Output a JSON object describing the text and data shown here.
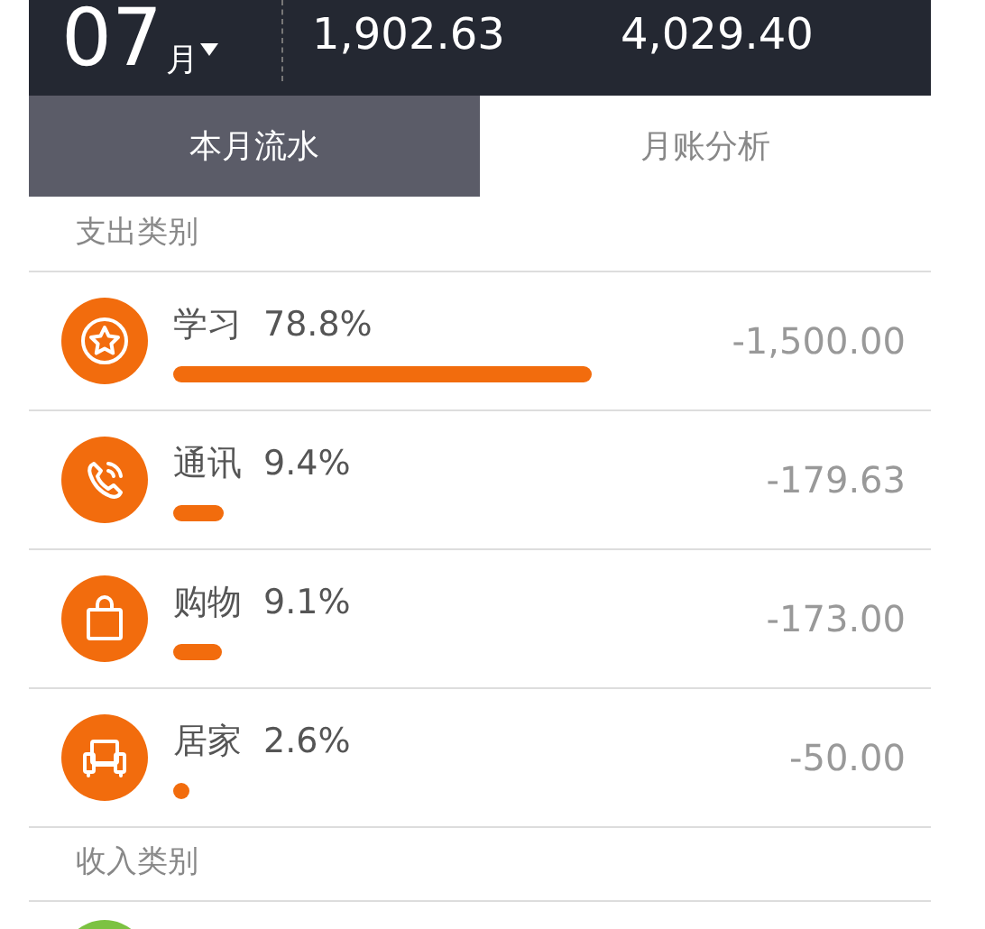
{
  "header": {
    "month": "07",
    "month_unit": "月",
    "values": [
      "1,902.63",
      "4,029.40"
    ]
  },
  "tabs": [
    {
      "label": "本月流水",
      "selected": true
    },
    {
      "label": "月账分析",
      "selected": false
    }
  ],
  "expense_section": {
    "title": "支出类别"
  },
  "expenses": [
    {
      "kind": "star",
      "name": "学习",
      "percent": "78.8%",
      "amount": "-1,500.00",
      "color": "#f26c0d"
    },
    {
      "kind": "phone",
      "name": "通讯",
      "percent": "9.4%",
      "amount": "-179.63",
      "color": "#f26c0d"
    },
    {
      "kind": "bag",
      "name": "购物",
      "percent": "9.1%",
      "amount": "-173.00",
      "color": "#f26c0d"
    },
    {
      "kind": "sofa",
      "name": "居家",
      "percent": "2.6%",
      "amount": "-50.00",
      "color": "#f26c0d"
    }
  ],
  "income_section": {
    "title": "收入类别"
  },
  "income_partial": {
    "color": "#7cc242"
  }
}
